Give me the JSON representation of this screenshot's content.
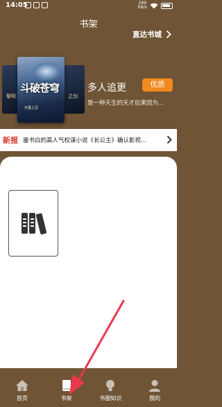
{
  "status_bar": {
    "time": "14:05",
    "net_speed_value": "269",
    "net_speed_unit": "KB/s",
    "battery_icon": "battery-icon",
    "wifi_icon": "wifi-icon"
  },
  "header": {
    "title": "书架",
    "goto_store_label": "直达书城"
  },
  "banner": {
    "heading": "多人追更",
    "badge": "优质",
    "description": "是一种天生的天才后果因为...",
    "cover_title": "斗破苍穹",
    "cover_author": "天蚕土豆",
    "side_book_left": "黎明",
    "side_book_right": "之剑"
  },
  "news": {
    "tag": "新报",
    "text": "墨书白的高人气权谋小说《长公主》确认影视..."
  },
  "shelf": {
    "add_card_icon": "books-icon"
  },
  "tabs": [
    {
      "label": "首页",
      "icon": "home-icon"
    },
    {
      "label": "书架",
      "icon": "bookshelf-icon",
      "active": true
    },
    {
      "label": "书圈知识",
      "icon": "lightbulb-icon"
    },
    {
      "label": "我的",
      "icon": "user-icon"
    }
  ],
  "colors": {
    "background": "#6f5436",
    "accent": "#f08a1f",
    "news_tag": "#d33a2c",
    "annotation_arrow": "#e83a4a"
  }
}
